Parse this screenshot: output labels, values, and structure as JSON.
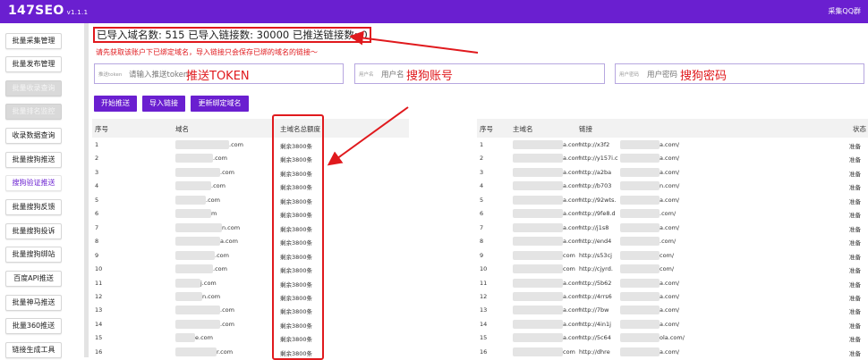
{
  "header": {
    "logo": "147SEO",
    "version": "v1.1.1",
    "qq_link": "采集QQ群"
  },
  "sidebar": {
    "items": [
      {
        "label": "批量采集管理",
        "state": "normal"
      },
      {
        "label": "批量发布管理",
        "state": "normal"
      },
      {
        "label": "批量收录查询",
        "state": "disabled"
      },
      {
        "label": "批量排名监控",
        "state": "disabled"
      },
      {
        "label": "收录数据查询",
        "state": "normal"
      },
      {
        "label": "批量搜狗推送",
        "state": "normal"
      },
      {
        "label": "搜狗验证推送",
        "state": "active"
      },
      {
        "label": "批量搜狗反馈",
        "state": "normal"
      },
      {
        "label": "批量搜狗投诉",
        "state": "normal"
      },
      {
        "label": "批量搜狗绑站",
        "state": "normal"
      },
      {
        "label": "百度API推送",
        "state": "normal"
      },
      {
        "label": "批量神马推送",
        "state": "normal"
      },
      {
        "label": "批量360推送",
        "state": "normal"
      },
      {
        "label": "链接生成工具",
        "state": "normal"
      }
    ]
  },
  "stats_text": "已导入域名数: 515 已导入链接数: 30000 已推送链接数: 0",
  "tip_text": "请先获取该账户下已绑定域名，导入链接只会保存已绑的域名的链接～",
  "fields": {
    "token": {
      "small_label": "推送token",
      "placeholder": "请输入推送token",
      "annotation": "推送TOKEN"
    },
    "username": {
      "small_label": "用户名",
      "placeholder": "用户名",
      "annotation": "搜狗账号"
    },
    "password": {
      "small_label": "用户密码",
      "placeholder": "用户密码",
      "annotation": "搜狗密码"
    }
  },
  "buttons": {
    "start": "开始推送",
    "import": "导入链接",
    "refresh": "更新绑定域名"
  },
  "left_table": {
    "headers": [
      "序号",
      "域名",
      "主域名总额度"
    ],
    "rows": [
      {
        "no": "1",
        "domain_end": ".com",
        "quota": "剩余3800条"
      },
      {
        "no": "2",
        "domain_end": ".com",
        "quota": "剩余3800条"
      },
      {
        "no": "3",
        "domain_end": ".com",
        "quota": "剩余3800条"
      },
      {
        "no": "4",
        "domain_end": ".com",
        "quota": "剩余3800条"
      },
      {
        "no": "5",
        "domain_end": ".com",
        "quota": "剩余3800条"
      },
      {
        "no": "6",
        "domain_end": "m",
        "quota": "剩余3800条"
      },
      {
        "no": "7",
        "domain_end": "n.com",
        "quota": "剩余3800条"
      },
      {
        "no": "8",
        "domain_end": "a.com",
        "quota": "剩余3800条"
      },
      {
        "no": "9",
        "domain_end": ".com",
        "quota": "剩余3800条"
      },
      {
        "no": "10",
        "domain_end": ".com",
        "quota": "剩余3800条"
      },
      {
        "no": "11",
        "domain_end": "j.com",
        "quota": "剩余3800条"
      },
      {
        "no": "12",
        "domain_end": "n.com",
        "quota": "剩余3800条"
      },
      {
        "no": "13",
        "domain_end": ".com",
        "quota": "剩余3800条"
      },
      {
        "no": "14",
        "domain_end": ".com",
        "quota": "剩余3800条"
      },
      {
        "no": "15",
        "domain_end": "e.com",
        "quota": "剩余3800条"
      },
      {
        "no": "16",
        "domain_end": "r.com",
        "quota": "剩余3800条"
      }
    ]
  },
  "right_table": {
    "headers": [
      "序号",
      "主域名",
      "链接",
      "状态"
    ],
    "rows": [
      {
        "no": "1",
        "main": "a.com",
        "link": "http://x3f2",
        "link_end": "a.com/",
        "status": "准备"
      },
      {
        "no": "2",
        "main": "a.com",
        "link": "http://y157i.c",
        "link_end": "a.com/",
        "status": "准备"
      },
      {
        "no": "3",
        "main": "a.com",
        "link": "http://a2ba",
        "link_end": "a.com/",
        "status": "准备"
      },
      {
        "no": "4",
        "main": "a.com",
        "link": "http://b703",
        "link_end": "n.com/",
        "status": "准备"
      },
      {
        "no": "5",
        "main": "a.com",
        "link": "http://92wts.",
        "link_end": "a.com/",
        "status": "准备"
      },
      {
        "no": "6",
        "main": "a.com",
        "link": "http://9fe8.d",
        "link_end": ".com/",
        "status": "准备"
      },
      {
        "no": "7",
        "main": "a.com",
        "link": "http://j1s8",
        "link_end": "a.com/",
        "status": "准备"
      },
      {
        "no": "8",
        "main": "a.com",
        "link": "http://end4",
        "link_end": ".com/",
        "status": "准备"
      },
      {
        "no": "9",
        "main": "com",
        "link": "http://s53cj",
        "link_end": "com/",
        "status": "准备"
      },
      {
        "no": "10",
        "main": "com",
        "link": "http://cjyrd.",
        "link_end": "com/",
        "status": "准备"
      },
      {
        "no": "11",
        "main": "a.com",
        "link": "http://5b62",
        "link_end": "a.com/",
        "status": "准备"
      },
      {
        "no": "12",
        "main": "a.com",
        "link": "http://4rrs6",
        "link_end": "a.com/",
        "status": "准备"
      },
      {
        "no": "13",
        "main": "a.com",
        "link": "http://7bw",
        "link_end": "a.com/",
        "status": "准备"
      },
      {
        "no": "14",
        "main": "a.com",
        "link": "http://4in1j",
        "link_end": "a.com/",
        "status": "准备"
      },
      {
        "no": "15",
        "main": "a.com",
        "link": "http://5c64",
        "link_end": "ola.com/",
        "status": "准备"
      },
      {
        "no": "16",
        "main": "com",
        "link": "http://dhre",
        "link_end": "a.com/",
        "status": "准备"
      }
    ]
  },
  "colors": {
    "primary": "#6a1fd0",
    "annotation_red": "#e0191d"
  }
}
